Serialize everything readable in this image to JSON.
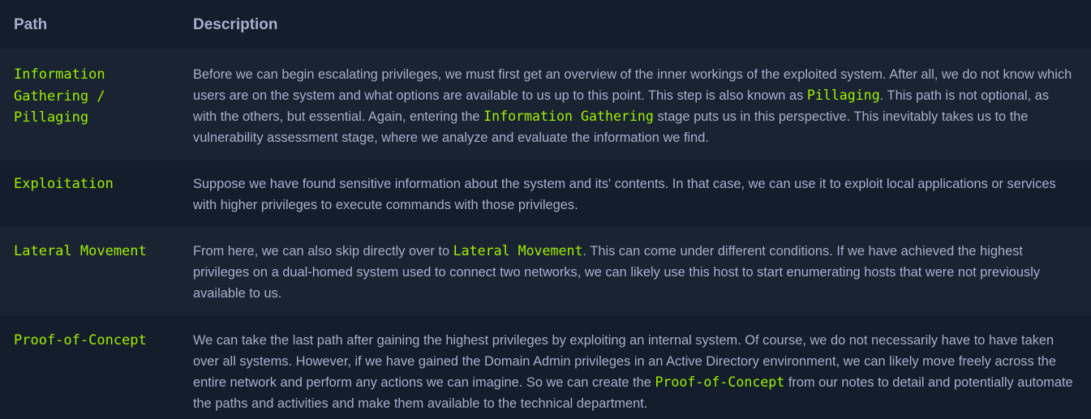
{
  "table": {
    "headers": {
      "path": "Path",
      "description": "Description"
    },
    "rows": [
      {
        "path_lines": [
          "Information",
          "Gathering /",
          "Pillaging"
        ],
        "desc": {
          "t1": "Before we can begin escalating privileges, we must first get an overview of the inner workings of the exploited system. After all, we do not know which users are on the system and what options are available to us up to this point. This step is also known as ",
          "c1": "Pillaging",
          "t2": ". This path is not optional, as with the others, but essential. Again, entering the ",
          "c2": "Information Gathering",
          "t3": " stage puts us in this perspective. This inevitably takes us to the vulnerability assessment stage, where we analyze and evaluate the information we find."
        }
      },
      {
        "path": "Exploitation",
        "desc": {
          "t1": "Suppose we have found sensitive information about the system and its' contents. In that case, we can use it to exploit local applications or services with higher privileges to execute commands with those privileges."
        }
      },
      {
        "path": "Lateral Movement",
        "desc": {
          "t1": "From here, we can also skip directly over to ",
          "c1": "Lateral Movement",
          "t2": ". This can come under different conditions. If we have achieved the highest privileges on a dual-homed system used to connect two networks, we can likely use this host to start enumerating hosts that were not previously available to us."
        }
      },
      {
        "path": "Proof-of-Concept",
        "desc": {
          "t1": "We can take the last path after gaining the highest privileges by exploiting an internal system. Of course, we do not necessarily have to have taken over all systems. However, if we have gained the Domain Admin privileges in an Active Directory environment, we can likely move freely across the entire network and perform any actions we can imagine. So we can create the ",
          "c1": "Proof-of-Concept",
          "t2": " from our notes to detail and potentially automate the paths and activities and make them available to the technical department."
        }
      }
    ]
  },
  "colors": {
    "background": "#141d2b",
    "row_alt": "#1a2332",
    "text": "#a4b1cd",
    "accent_green": "#9fef00"
  }
}
